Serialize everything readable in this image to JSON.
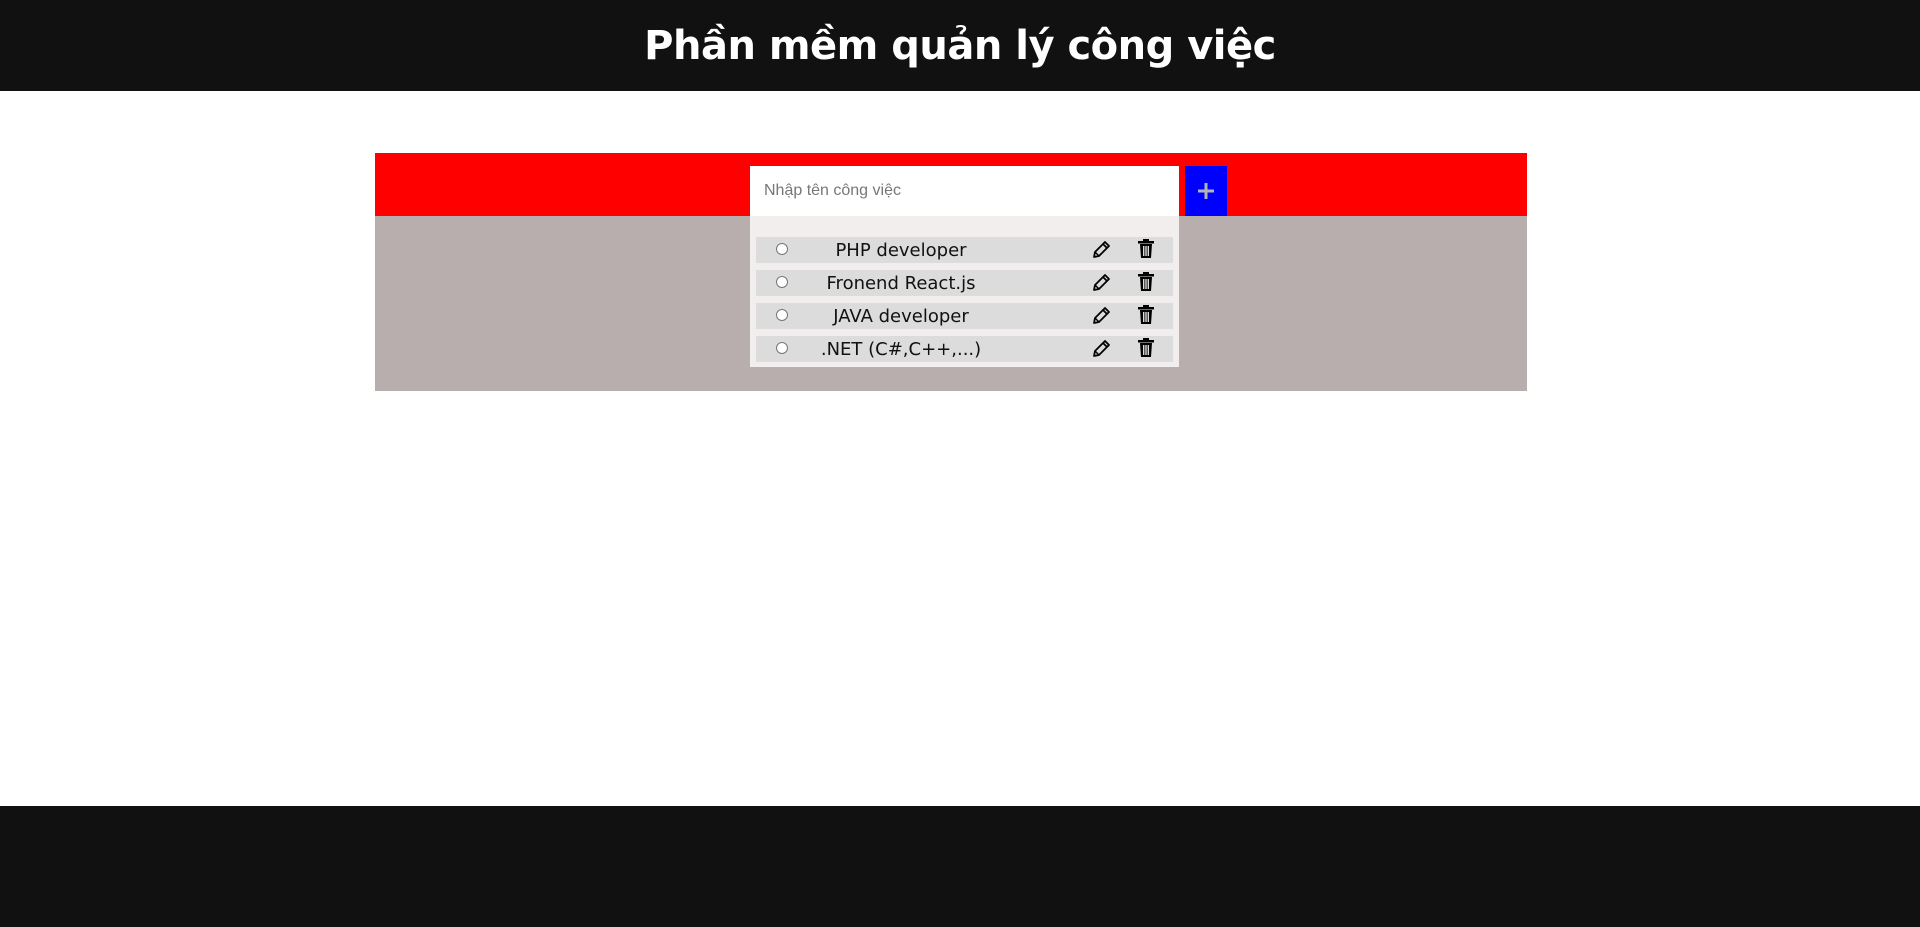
{
  "header": {
    "title": "Phần mềm quản lý công việc"
  },
  "form": {
    "input_value": "",
    "input_placeholder": "Nhập tên công việc",
    "add_icon": "plus-icon"
  },
  "tasks": [
    {
      "name": "PHP developer",
      "checked": false
    },
    {
      "name": "Fronend React.js",
      "checked": false
    },
    {
      "name": "JAVA developer",
      "checked": false
    },
    {
      "name": ".NET (C#,C++,...)",
      "checked": false
    }
  ],
  "icons": {
    "edit": "pencil-icon",
    "delete": "trash-icon"
  },
  "colors": {
    "header_bg": "#111111",
    "input_bar_bg": "#ff0000",
    "add_button_bg": "#0000ff",
    "container_bg": "#b8aeae",
    "list_panel_bg": "#f2eeee",
    "row_bg": "#dcdcdc",
    "footer_bg": "#111111"
  }
}
